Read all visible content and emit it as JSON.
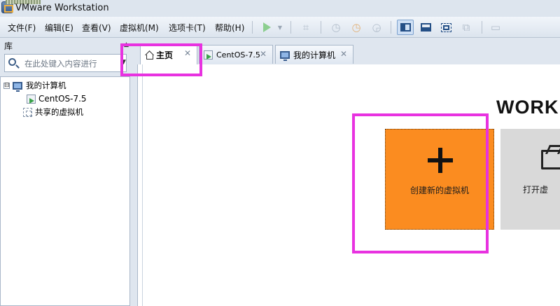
{
  "window": {
    "title": "VMware Workstation"
  },
  "menu": {
    "items": [
      "文件(F)",
      "编辑(E)",
      "查看(V)",
      "虚拟机(M)",
      "选项卡(T)",
      "帮助(H)"
    ]
  },
  "toolbar": {
    "icons": [
      "play-icon",
      "dropdown-caret-icon",
      "network-icon",
      "snapshot-icon",
      "snapshot-revert-icon",
      "snapshot-manager-icon",
      "library-view-icon",
      "console-view-icon",
      "fullscreen-icon",
      "unity-icon",
      "preferences-icon"
    ]
  },
  "library": {
    "title": "库",
    "search_placeholder": "在此处键入内容进行",
    "tree": [
      {
        "label": "我的计算机",
        "icon": "monitor-icon",
        "expander": "⊟"
      },
      {
        "label": "CentOS-7.5",
        "icon": "vm-icon"
      },
      {
        "label": "共享的虚拟机",
        "icon": "shared-vm-icon"
      }
    ]
  },
  "tabs": [
    {
      "label": "主页",
      "icon": "home-icon",
      "active": true
    },
    {
      "label": "CentOS-7.5",
      "icon": "vm-icon",
      "active": false
    },
    {
      "label": "我的计算机",
      "icon": "monitor-icon",
      "active": false
    }
  ],
  "home": {
    "heading": "WORK",
    "create_card": {
      "label": "创建新的虚拟机",
      "color": "#fb8c20"
    },
    "open_card": {
      "label": "打开虚",
      "color": "#d9d9d9"
    }
  },
  "colors": {
    "highlight": "#e832e0",
    "chrome": "#dfe6ef"
  }
}
